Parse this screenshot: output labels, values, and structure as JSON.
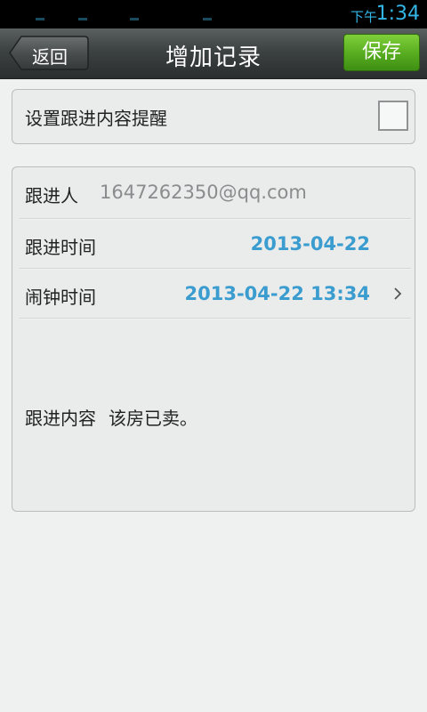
{
  "status_bar": {
    "ampm": "下午",
    "time": "1:34"
  },
  "header": {
    "back_label": "返回",
    "title": "增加记录",
    "save_label": "保存"
  },
  "reminder": {
    "label": "设置跟进内容提醒",
    "checked": false
  },
  "details": {
    "follower_label": "跟进人",
    "follower_value": "1647262350@qq.com",
    "follow_time_label": "跟进时间",
    "follow_time_value": "2013-04-22",
    "alarm_time_label": "闹钟时间",
    "alarm_time_value": "2013-04-22 13:34",
    "content_label": "跟进内容",
    "content_value": "该房已卖。"
  },
  "colors": {
    "accent_blue": "#3a9ccf",
    "save_green": "#56ab1f",
    "status_blue": "#33b5e5"
  },
  "icons": {
    "chevron": "chevron-right-icon",
    "back": "back-arrow-button"
  }
}
